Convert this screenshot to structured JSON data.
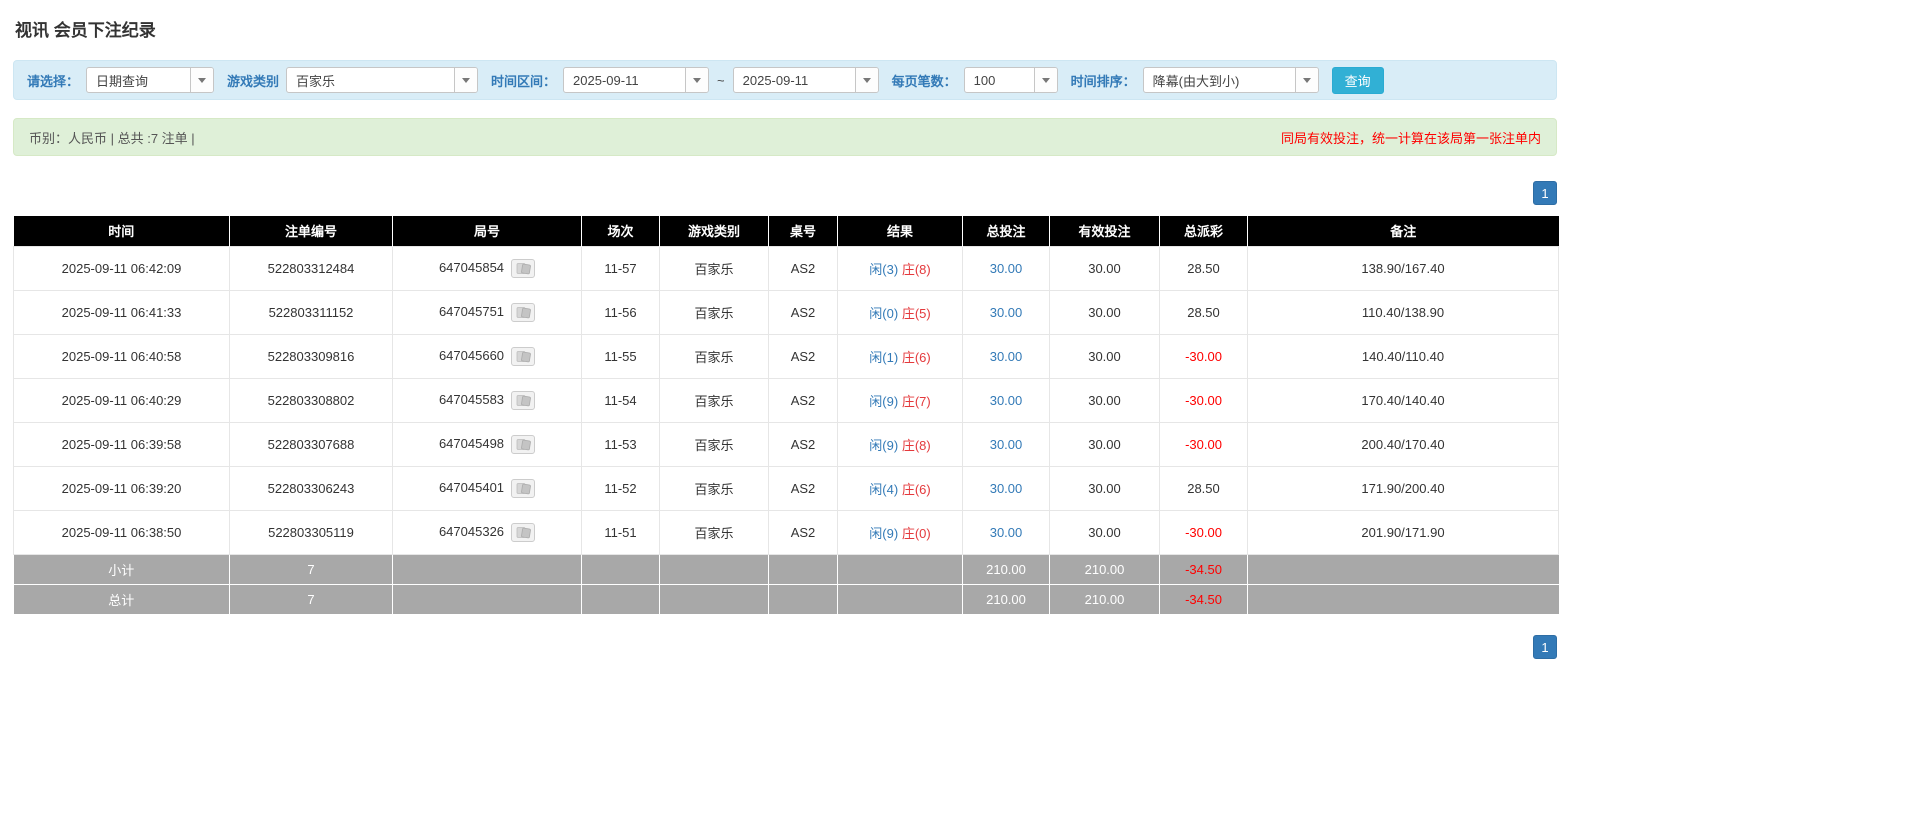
{
  "page": {
    "title": "视讯 会员下注纪录"
  },
  "filters": {
    "select_label": "请选择：",
    "select_value": "日期查询",
    "game_type_label": "游戏类别",
    "game_type_value": "百家乐",
    "date_range_label": "时间区间：",
    "date_from": "2025-09-11",
    "date_separator": "~",
    "date_to": "2025-09-11",
    "page_size_label": "每页笔数：",
    "page_size_value": "100",
    "sort_label": "时间排序：",
    "sort_value": "降幕(由大到小)",
    "search_button": "查询"
  },
  "summary": {
    "left_text": "币别：人民币 | 总共 :7 注单 |",
    "right_note": "同局有效投注，统一计算在该局第一张注单内"
  },
  "pagination": {
    "page": "1"
  },
  "table": {
    "headers": [
      "时间",
      "注单编号",
      "局号",
      "场次",
      "游戏类别",
      "桌号",
      "结果",
      "总投注",
      "有效投注",
      "总派彩",
      "备注"
    ],
    "rows": [
      {
        "time": "2025-09-11 06:42:09",
        "bet_id": "522803312484",
        "round_id": "647045854",
        "session": "11-57",
        "game": "百家乐",
        "table_no": "AS2",
        "player": "闲(3)",
        "banker": "庄(8)",
        "total_bet": "30.00",
        "valid_bet": "30.00",
        "payout": "28.50",
        "remark": "138.90/167.40"
      },
      {
        "time": "2025-09-11 06:41:33",
        "bet_id": "522803311152",
        "round_id": "647045751",
        "session": "11-56",
        "game": "百家乐",
        "table_no": "AS2",
        "player": "闲(0)",
        "banker": "庄(5)",
        "total_bet": "30.00",
        "valid_bet": "30.00",
        "payout": "28.50",
        "remark": "110.40/138.90"
      },
      {
        "time": "2025-09-11 06:40:58",
        "bet_id": "522803309816",
        "round_id": "647045660",
        "session": "11-55",
        "game": "百家乐",
        "table_no": "AS2",
        "player": "闲(1)",
        "banker": "庄(6)",
        "total_bet": "30.00",
        "valid_bet": "30.00",
        "payout": "-30.00",
        "remark": "140.40/110.40"
      },
      {
        "time": "2025-09-11 06:40:29",
        "bet_id": "522803308802",
        "round_id": "647045583",
        "session": "11-54",
        "game": "百家乐",
        "table_no": "AS2",
        "player": "闲(9)",
        "banker": "庄(7)",
        "total_bet": "30.00",
        "valid_bet": "30.00",
        "payout": "-30.00",
        "remark": "170.40/140.40"
      },
      {
        "time": "2025-09-11 06:39:58",
        "bet_id": "522803307688",
        "round_id": "647045498",
        "session": "11-53",
        "game": "百家乐",
        "table_no": "AS2",
        "player": "闲(9)",
        "banker": "庄(8)",
        "total_bet": "30.00",
        "valid_bet": "30.00",
        "payout": "-30.00",
        "remark": "200.40/170.40"
      },
      {
        "time": "2025-09-11 06:39:20",
        "bet_id": "522803306243",
        "round_id": "647045401",
        "session": "11-52",
        "game": "百家乐",
        "table_no": "AS2",
        "player": "闲(4)",
        "banker": "庄(6)",
        "total_bet": "30.00",
        "valid_bet": "30.00",
        "payout": "28.50",
        "remark": "171.90/200.40"
      },
      {
        "time": "2025-09-11 06:38:50",
        "bet_id": "522803305119",
        "round_id": "647045326",
        "session": "11-51",
        "game": "百家乐",
        "table_no": "AS2",
        "player": "闲(9)",
        "banker": "庄(0)",
        "total_bet": "30.00",
        "valid_bet": "30.00",
        "payout": "-30.00",
        "remark": "201.90/171.90"
      }
    ],
    "subtotal": {
      "label": "小计",
      "count": "7",
      "total_bet": "210.00",
      "valid_bet": "210.00",
      "payout": "-34.50"
    },
    "total": {
      "label": "总计",
      "count": "7",
      "total_bet": "210.00",
      "valid_bet": "210.00",
      "payout": "-34.50"
    }
  }
}
